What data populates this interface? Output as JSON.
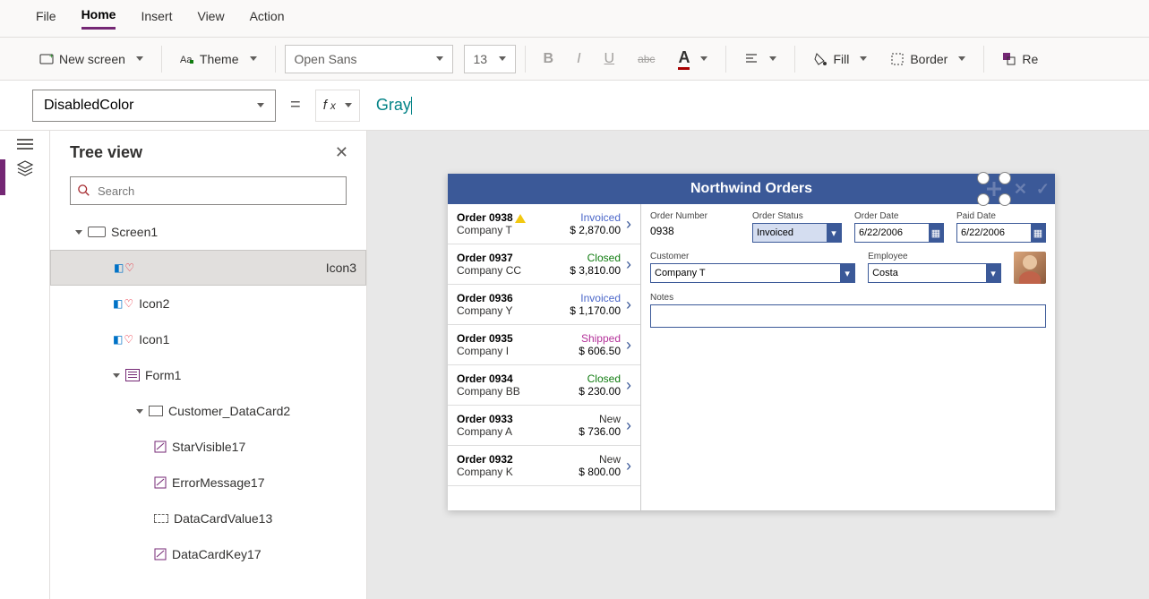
{
  "menu": {
    "file": "File",
    "home": "Home",
    "insert": "Insert",
    "view": "View",
    "action": "Action"
  },
  "toolbar": {
    "newscreen": "New screen",
    "theme": "Theme",
    "font": "Open Sans",
    "size": "13",
    "bold": "B",
    "italic": "I",
    "underline": "U",
    "strike": "abc",
    "fontcolor": "A",
    "fill": "Fill",
    "border": "Border",
    "reorder": "Re"
  },
  "formula": {
    "property": "DisabledColor",
    "value": "Gray"
  },
  "treeview": {
    "title": "Tree view",
    "search_ph": "Search",
    "screen": "Screen1",
    "nodes": [
      "Icon3",
      "Icon2",
      "Icon1",
      "Form1",
      "Customer_DataCard2",
      "StarVisible17",
      "ErrorMessage17",
      "DataCardValue13",
      "DataCardKey17"
    ]
  },
  "app": {
    "title": "Northwind Orders",
    "orders": [
      {
        "id": "Order 0938",
        "co": "Company T",
        "status": "Invoiced",
        "status_cls": "s-invoiced",
        "amt": "$ 2,870.00",
        "warn": true
      },
      {
        "id": "Order 0937",
        "co": "Company CC",
        "status": "Closed",
        "status_cls": "s-closed",
        "amt": "$ 3,810.00"
      },
      {
        "id": "Order 0936",
        "co": "Company Y",
        "status": "Invoiced",
        "status_cls": "s-invoiced",
        "amt": "$ 1,170.00"
      },
      {
        "id": "Order 0935",
        "co": "Company I",
        "status": "Shipped",
        "status_cls": "s-shipped",
        "amt": "$ 606.50"
      },
      {
        "id": "Order 0934",
        "co": "Company BB",
        "status": "Closed",
        "status_cls": "s-closed",
        "amt": "$ 230.00"
      },
      {
        "id": "Order 0933",
        "co": "Company A",
        "status": "New",
        "status_cls": "s-new",
        "amt": "$ 736.00"
      },
      {
        "id": "Order 0932",
        "co": "Company K",
        "status": "New",
        "status_cls": "s-new",
        "amt": "$ 800.00"
      }
    ],
    "form": {
      "ordernum_l": "Order Number",
      "ordernum": "0938",
      "orderstatus_l": "Order Status",
      "orderstatus": "Invoiced",
      "orderdate_l": "Order Date",
      "orderdate": "6/22/2006",
      "paiddate_l": "Paid Date",
      "paiddate": "6/22/2006",
      "customer_l": "Customer",
      "customer": "Company T",
      "employee_l": "Employee",
      "employee": "Costa",
      "notes_l": "Notes"
    }
  }
}
